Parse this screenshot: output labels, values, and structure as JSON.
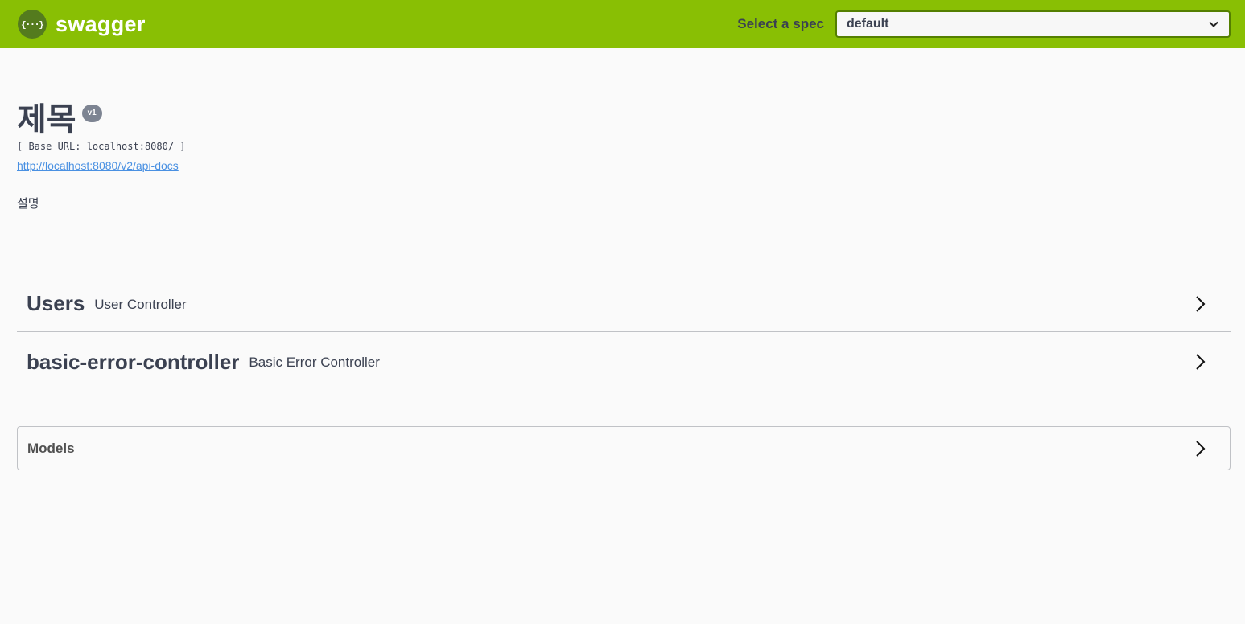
{
  "topbar": {
    "logo_glyph": "{···}",
    "logo_text": "swagger",
    "spec_label": "Select a spec",
    "spec_selected": "default"
  },
  "info": {
    "title": "제목",
    "version": "v1",
    "base_url": "[ Base URL: localhost:8080/ ]",
    "docs_link": "http://localhost:8080/v2/api-docs",
    "description": "설명"
  },
  "tags": [
    {
      "name": "Users",
      "description": "User Controller"
    },
    {
      "name": "basic-error-controller",
      "description": "Basic Error Controller"
    }
  ],
  "models": {
    "title": "Models"
  },
  "colors": {
    "topbar": "#89bf04",
    "logo_circle": "#547b1e",
    "link": "#4990e2",
    "text": "#3b4151"
  }
}
